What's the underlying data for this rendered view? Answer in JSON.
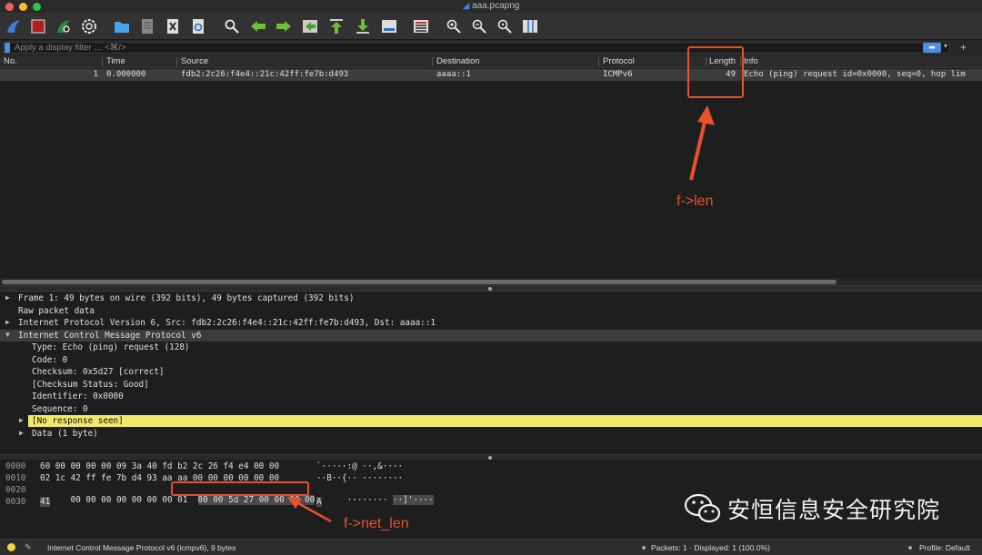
{
  "window": {
    "title": "aaa.pcapng",
    "colors": {
      "close": "#fe5f57",
      "minimize": "#febb2e",
      "zoom": "#28c840"
    }
  },
  "toolbar": {
    "icons": [
      "shark-fin-icon",
      "stop-icon",
      "restart-icon",
      "gear-icon",
      "folder-icon",
      "file-icon",
      "close-file-icon",
      "reload-icon",
      "search-icon",
      "arrow-left-icon",
      "arrow-right-icon",
      "go-to-packet-icon",
      "first-packet-icon",
      "last-packet-icon",
      "autoscroll-icon",
      "colorize-icon",
      "zoom-in-icon",
      "zoom-out-icon",
      "zoom-reset-icon",
      "resize-columns-icon"
    ]
  },
  "filter": {
    "placeholder": "Apply a display filter … <⌘/>",
    "add_label": "+"
  },
  "packet_list": {
    "columns": [
      "No.",
      "Time",
      "Source",
      "Destination",
      "Protocol",
      "Length",
      "Info"
    ],
    "rows": [
      {
        "no": "1",
        "time": "0.000000",
        "source": "fdb2:2c26:f4e4::21c:42ff:fe7b:d493",
        "destination": "aaaa::1",
        "protocol": "ICMPv6",
        "length": "49",
        "info": "Echo (ping) request id=0x0000, seq=0, hop lim"
      }
    ]
  },
  "details": [
    {
      "arrow": "▶",
      "indent": 0,
      "text": "Frame 1: 49 bytes on wire (392 bits), 49 bytes captured (392 bits)"
    },
    {
      "arrow": "",
      "indent": 0,
      "text": "Raw packet data"
    },
    {
      "arrow": "▶",
      "indent": 0,
      "text": "Internet Protocol Version 6, Src: fdb2:2c26:f4e4::21c:42ff:fe7b:d493, Dst: aaaa::1"
    },
    {
      "arrow": "▼",
      "indent": 0,
      "text": "Internet Control Message Protocol v6"
    },
    {
      "arrow": "",
      "indent": 1,
      "text": "Type: Echo (ping) request (128)"
    },
    {
      "arrow": "",
      "indent": 1,
      "text": "Code: 0"
    },
    {
      "arrow": "",
      "indent": 1,
      "text": "Checksum: 0x5d27 [correct]"
    },
    {
      "arrow": "",
      "indent": 1,
      "text": "[Checksum Status: Good]"
    },
    {
      "arrow": "",
      "indent": 1,
      "text": "Identifier: 0x0000"
    },
    {
      "arrow": "",
      "indent": 1,
      "text": "Sequence: 0"
    },
    {
      "arrow": "▶",
      "indent": 1,
      "text": "[No response seen]"
    },
    {
      "arrow": "▶",
      "indent": 1,
      "text": "Data (1 byte)"
    }
  ],
  "bytes": [
    {
      "offset": "0000",
      "hex": "60 00 00 00 00 09 3a 40  fd b2 2c 26 f4 e4 00 00",
      "ascii": "`·····:@ ··,&····"
    },
    {
      "offset": "0010",
      "hex": "02 1c 42 ff fe 7b d4 93  aa aa 00 00 00 00 00 00",
      "ascii": "··B··{·· ········"
    },
    {
      "offset": "0020",
      "hex_a": "00 00 00 00 00 00 00 01  ",
      "hex_b": "80 00 5d 27 00 00 00 00",
      "ascii_a": "········ ",
      "ascii_b": "··]'····"
    },
    {
      "offset": "0030",
      "hex": "41",
      "ascii": "A"
    }
  ],
  "status": {
    "left": "Internet Control Message Protocol v6 (icmpv6), 9 bytes",
    "packets": "Packets: 1 · Displayed: 1 (100.0%)",
    "profile": "Profile: Default"
  },
  "annotations": {
    "len_label": "f->len",
    "net_len_label": "f->net_len",
    "color": "#e8502f"
  },
  "watermark": {
    "text": "安恒信息安全研究院"
  }
}
